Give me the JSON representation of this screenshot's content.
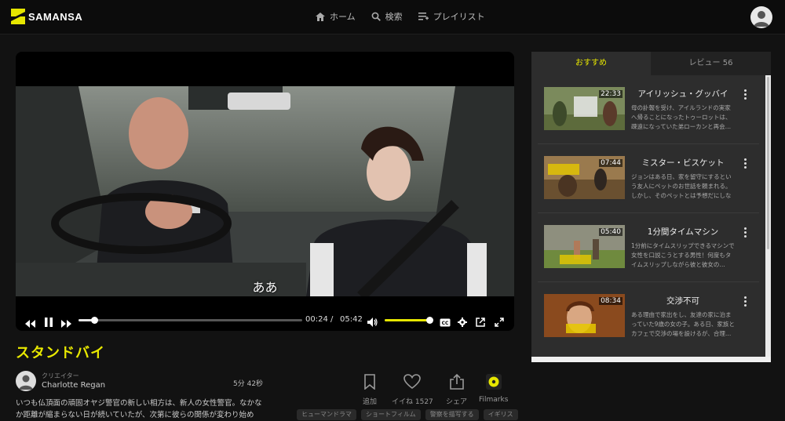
{
  "app": {
    "logo_text": "SAMANSA",
    "colors": {
      "accent": "#e6e600",
      "background": "#121212",
      "panel": "#2d2d2d"
    }
  },
  "nav": {
    "items": [
      {
        "label": "ホーム",
        "icon": "home-icon"
      },
      {
        "label": "検索",
        "icon": "search-icon"
      },
      {
        "label": "プレイリスト",
        "icon": "playlist-icon"
      }
    ]
  },
  "player": {
    "subtitle": "ああ",
    "current_time": "00:24",
    "separator": "/",
    "total_time": "05:42",
    "progress": 0.07,
    "volume": 1.0
  },
  "video": {
    "title": "スタンドバイ",
    "creator_role": "クリエイター",
    "creator_name": "Charlotte Regan",
    "duration": "5分 42秒",
    "description": "いつも仏頂面の頑固オヤジ警官の新しい相方は、新人の女性警官。なかなか距離が縮まらない日が続いていたが、次第に彼らの関係が変わり始め",
    "actions": [
      {
        "label": "追加",
        "icon": "bookmark-icon"
      },
      {
        "label": "イイね 1527",
        "icon": "heart-icon"
      },
      {
        "label": "シェア",
        "icon": "share-icon"
      },
      {
        "label": "Filmarks",
        "icon": "filmarks-icon"
      }
    ],
    "tags": [
      "ヒューマンドラマ",
      "ショートフィルム",
      "警察を描写する",
      "イギリス"
    ]
  },
  "panel": {
    "tab_recommended": "おすすめ",
    "tab_reviews": "レビュー 56",
    "items": [
      {
        "title": "アイリッシュ・グッバイ",
        "time": "22:33",
        "desc": "母の訃報を受け、アイルランドの実家へ帰ることになったトゥーロットは、疎遠になっていた弟ローカンと再会…"
      },
      {
        "title": "ミスター・ビスケット",
        "time": "07:44",
        "desc": "ジョンはある日、家を留守にするという友人にペットのお世話を頼まれる。しかし、そのペットとは予想だにしない…"
      },
      {
        "title": "1分間タイムマシン",
        "time": "05:40",
        "desc": "1分前にタイムスリップできるマシンで女性を口説こうとする男性！何度もタイムスリップしながら彼と彼女の…"
      },
      {
        "title": "交渉不可",
        "time": "08:34",
        "desc": "ある理由で家出をし、友達の家に泊まっていた9歳の女の子。ある日、家族とカフェで交渉の場を設けるが、合理…"
      }
    ]
  }
}
